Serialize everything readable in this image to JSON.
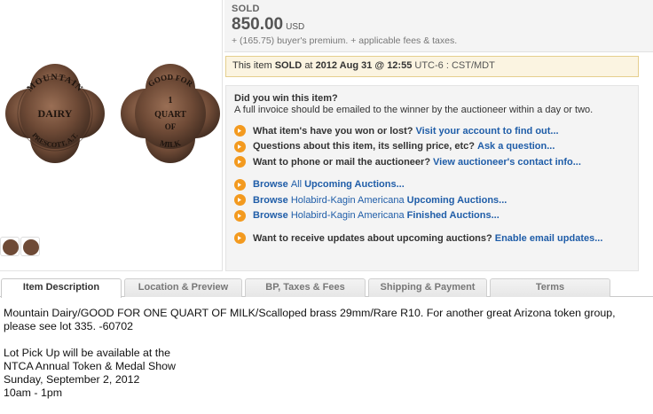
{
  "price": {
    "status": "SOLD",
    "amount": "850.00",
    "currency": "USD",
    "premium_note": "+ (165.75) buyer's premium. + applicable fees & taxes."
  },
  "sold_notice": {
    "prefix": "This item",
    "sold": "SOLD",
    "at": "at",
    "date": "2012 Aug 31 @ 12:55",
    "timezone": "UTC-6 : CST/MDT"
  },
  "win": {
    "title": "Did you win this item?",
    "subtitle": "A full invoice should be emailed to the winner by the auctioneer within a day or two."
  },
  "questions": [
    {
      "q": "What item's have you won or lost?",
      "link": "Visit your account to find out..."
    },
    {
      "q": "Questions about this item, its selling price, etc?",
      "link": "Ask a question..."
    },
    {
      "q": "Want to phone or mail the auctioneer?",
      "link": "View auctioneer's contact info..."
    }
  ],
  "browse": [
    {
      "b": "Browse",
      "mid": "All",
      "end": "Upcoming Auctions..."
    },
    {
      "b": "Browse",
      "mid": "Holabird-Kagin Americana",
      "end": "Upcoming Auctions..."
    },
    {
      "b": "Browse",
      "mid": "Holabird-Kagin Americana",
      "end": "Finished Auctions..."
    }
  ],
  "updates": {
    "q": "Want to receive updates about upcoming auctions?",
    "link": "Enable email updates..."
  },
  "tabs": [
    "Item Description",
    "Location & Preview",
    "BP, Taxes & Fees",
    "Shipping & Payment",
    "Terms"
  ],
  "description": {
    "main": "Mountain Dairy/GOOD FOR ONE QUART OF MILK/Scalloped brass 29mm/Rare R10. For another great Arizona token group, please see lot 335. -60702",
    "pickup": [
      "Lot Pick Up will be available at the",
      "NTCA Annual Token & Medal Show",
      "Sunday, September 2, 2012",
      "10am - 1pm"
    ]
  },
  "coin": {
    "obverse_text": [
      "MOUNTAIN",
      "DAIRY",
      "PRESCOTT, A.T."
    ],
    "reverse_text": [
      "GOOD FOR",
      "1",
      "QUART",
      "OF",
      "MILK"
    ]
  },
  "colors": {
    "link": "#1f5da8",
    "arrow": "#f39a1f",
    "notice_bg": "#fbf4e1"
  }
}
